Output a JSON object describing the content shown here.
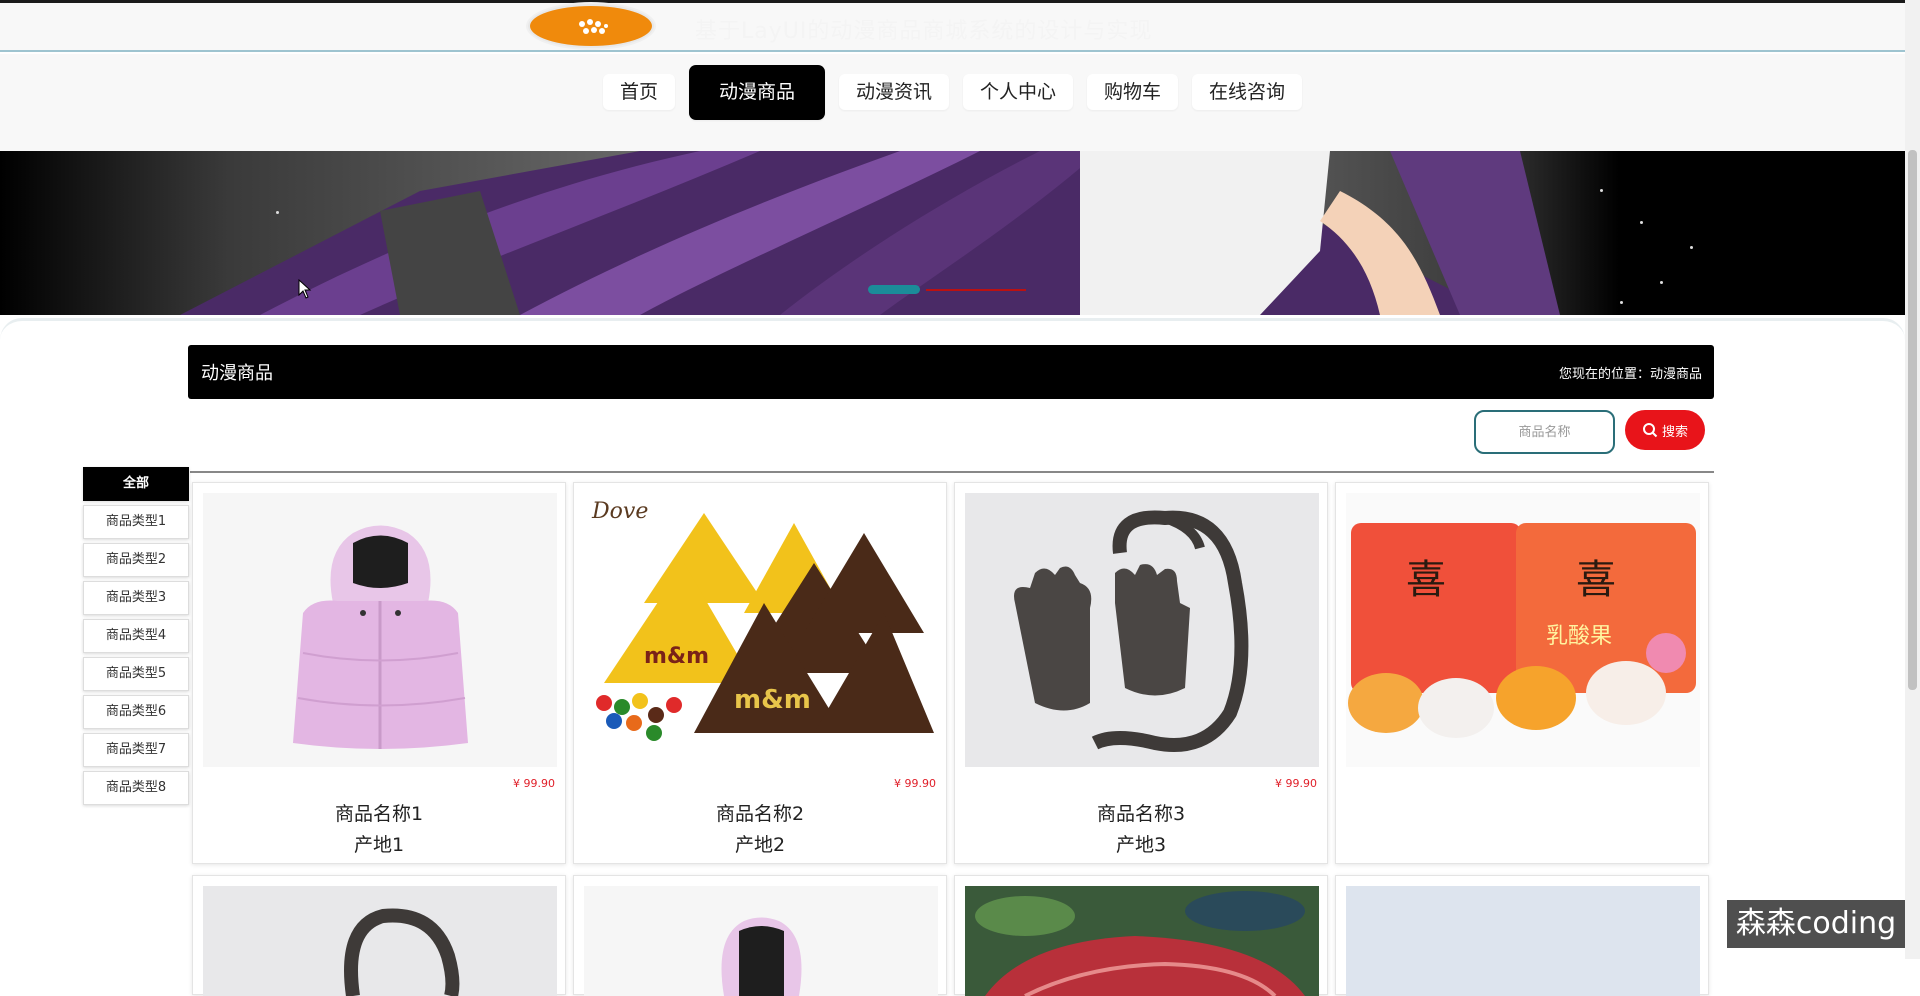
{
  "header": {
    "site_title": "基于LayUI的动漫商品商城系统的设计与实现",
    "logo_icon": "flower-logo-icon"
  },
  "nav": {
    "items": [
      {
        "label": "首页",
        "active": false
      },
      {
        "label": "动漫商品",
        "active": true
      },
      {
        "label": "动漫资讯",
        "active": false
      },
      {
        "label": "个人中心",
        "active": false
      },
      {
        "label": "购物车",
        "active": false
      },
      {
        "label": "在线咨询",
        "active": false
      }
    ]
  },
  "section": {
    "title": "动漫商品",
    "breadcrumb": "您现在的位置：动漫商品"
  },
  "search": {
    "placeholder": "商品名称",
    "button_label": "搜索",
    "button_icon": "search-icon"
  },
  "categories": [
    {
      "label": "全部",
      "active": true
    },
    {
      "label": "商品类型1",
      "active": false
    },
    {
      "label": "商品类型2",
      "active": false
    },
    {
      "label": "商品类型3",
      "active": false
    },
    {
      "label": "商品类型4",
      "active": false
    },
    {
      "label": "商品类型5",
      "active": false
    },
    {
      "label": "商品类型6",
      "active": false
    },
    {
      "label": "商品类型7",
      "active": false
    },
    {
      "label": "商品类型8",
      "active": false
    }
  ],
  "products": [
    {
      "name": "商品名称1",
      "origin": "产地1",
      "price": "¥ 99.90",
      "image": "pink-vest-jacket"
    },
    {
      "name": "商品名称2",
      "origin": "产地2",
      "price": "¥ 99.90",
      "image": "dove-mm-chocolates"
    },
    {
      "name": "商品名称3",
      "origin": "产地3",
      "price": "¥ 99.90",
      "image": "fur-gloves-scarf"
    },
    {
      "name": "",
      "origin": "",
      "price": "",
      "image": "jelly-pudding-pack"
    },
    {
      "name": "",
      "origin": "",
      "price": "",
      "image": "fur-gloves-scarf"
    },
    {
      "name": "",
      "origin": "",
      "price": "",
      "image": "pink-vest-jacket"
    },
    {
      "name": "",
      "origin": "",
      "price": "",
      "image": "raw-meat"
    },
    {
      "name": "",
      "origin": "",
      "price": "",
      "image": "blurred"
    }
  ],
  "watermark": "森森coding",
  "colors": {
    "accent": "#000000",
    "search_button": "#e8141a",
    "price": "#e0202a",
    "logo": "#f08a0c",
    "banner_dot": "#1b8c99"
  }
}
